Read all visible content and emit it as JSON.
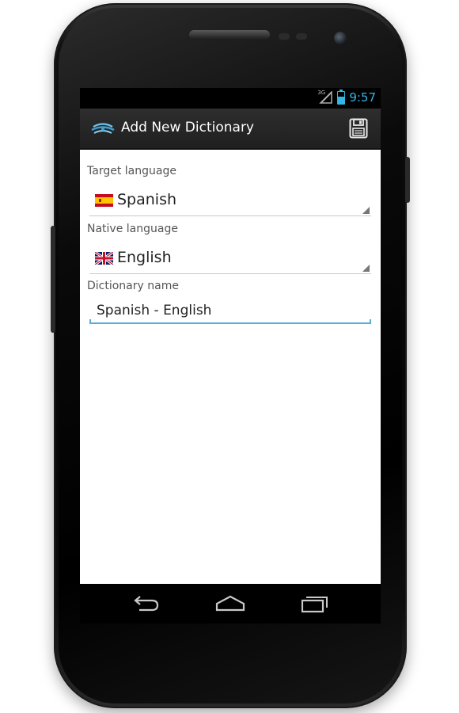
{
  "status_bar": {
    "network": "3G",
    "time": "9:57"
  },
  "action_bar": {
    "title": "Add New Dictionary",
    "app_icon": "dictionary-app-icon",
    "action_icon": "save-icon"
  },
  "form": {
    "target_language": {
      "label": "Target language",
      "value": "Spanish",
      "flag_icon": "spain-flag-icon"
    },
    "native_language": {
      "label": "Native language",
      "value": "English",
      "flag_icon": "uk-flag-icon"
    },
    "dictionary_name": {
      "label": "Dictionary name",
      "value": "Spanish - English"
    }
  },
  "nav_bar": {
    "back_icon": "back-icon",
    "home_icon": "home-icon",
    "recents_icon": "recents-icon"
  },
  "colors": {
    "accent": "#33b5e5",
    "action_bar": "#262626",
    "focus_underline": "#5aaed6"
  }
}
